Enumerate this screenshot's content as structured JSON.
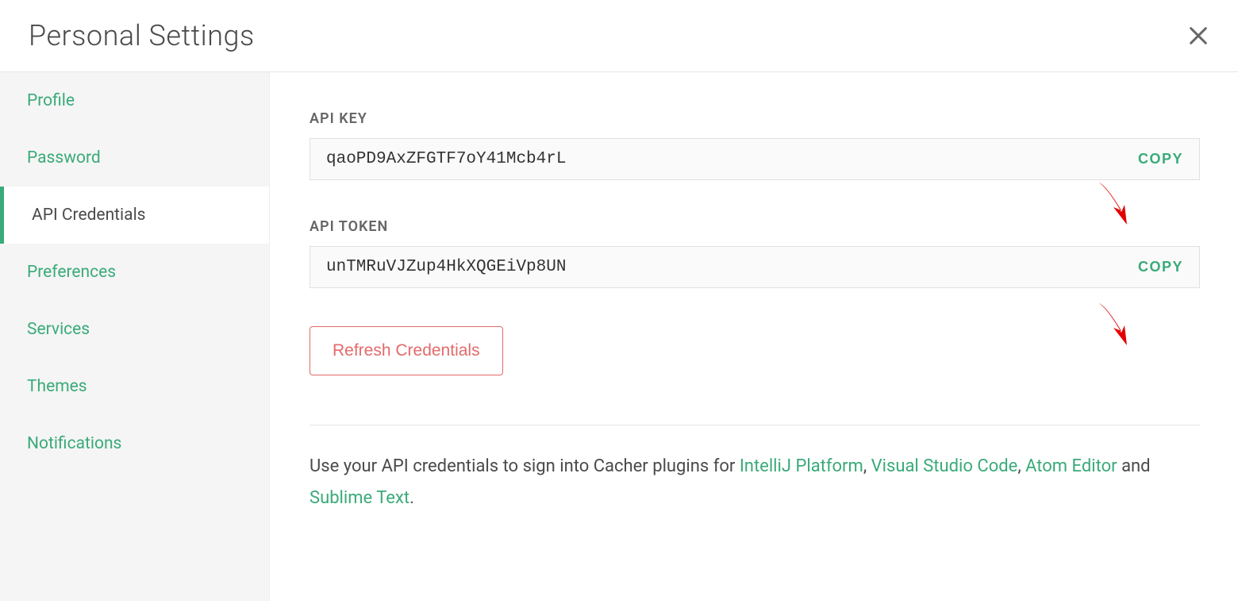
{
  "header": {
    "title": "Personal Settings"
  },
  "sidebar": {
    "items": [
      {
        "label": "Profile",
        "active": false
      },
      {
        "label": "Password",
        "active": false
      },
      {
        "label": "API Credentials",
        "active": true
      },
      {
        "label": "Preferences",
        "active": false
      },
      {
        "label": "Services",
        "active": false
      },
      {
        "label": "Themes",
        "active": false
      },
      {
        "label": "Notifications",
        "active": false
      }
    ]
  },
  "main": {
    "api_key_label": "API KEY",
    "api_key_value": "qaoPD9AxZFGTF7oY41Mcb4rL",
    "api_token_label": "API TOKEN",
    "api_token_value": "unTMRuVJZup4HkXQGEiVp8UN",
    "copy_label": "COPY",
    "refresh_label": "Refresh Credentials",
    "info_prefix": "Use your API credentials to sign into Cacher plugins for ",
    "link_intellij": "IntelliJ Platform",
    "sep_comma": ", ",
    "link_vscode": "Visual Studio Code",
    "link_atom": "Atom Editor",
    "sep_and": " and ",
    "link_sublime": "Sublime Text",
    "info_period": "."
  }
}
